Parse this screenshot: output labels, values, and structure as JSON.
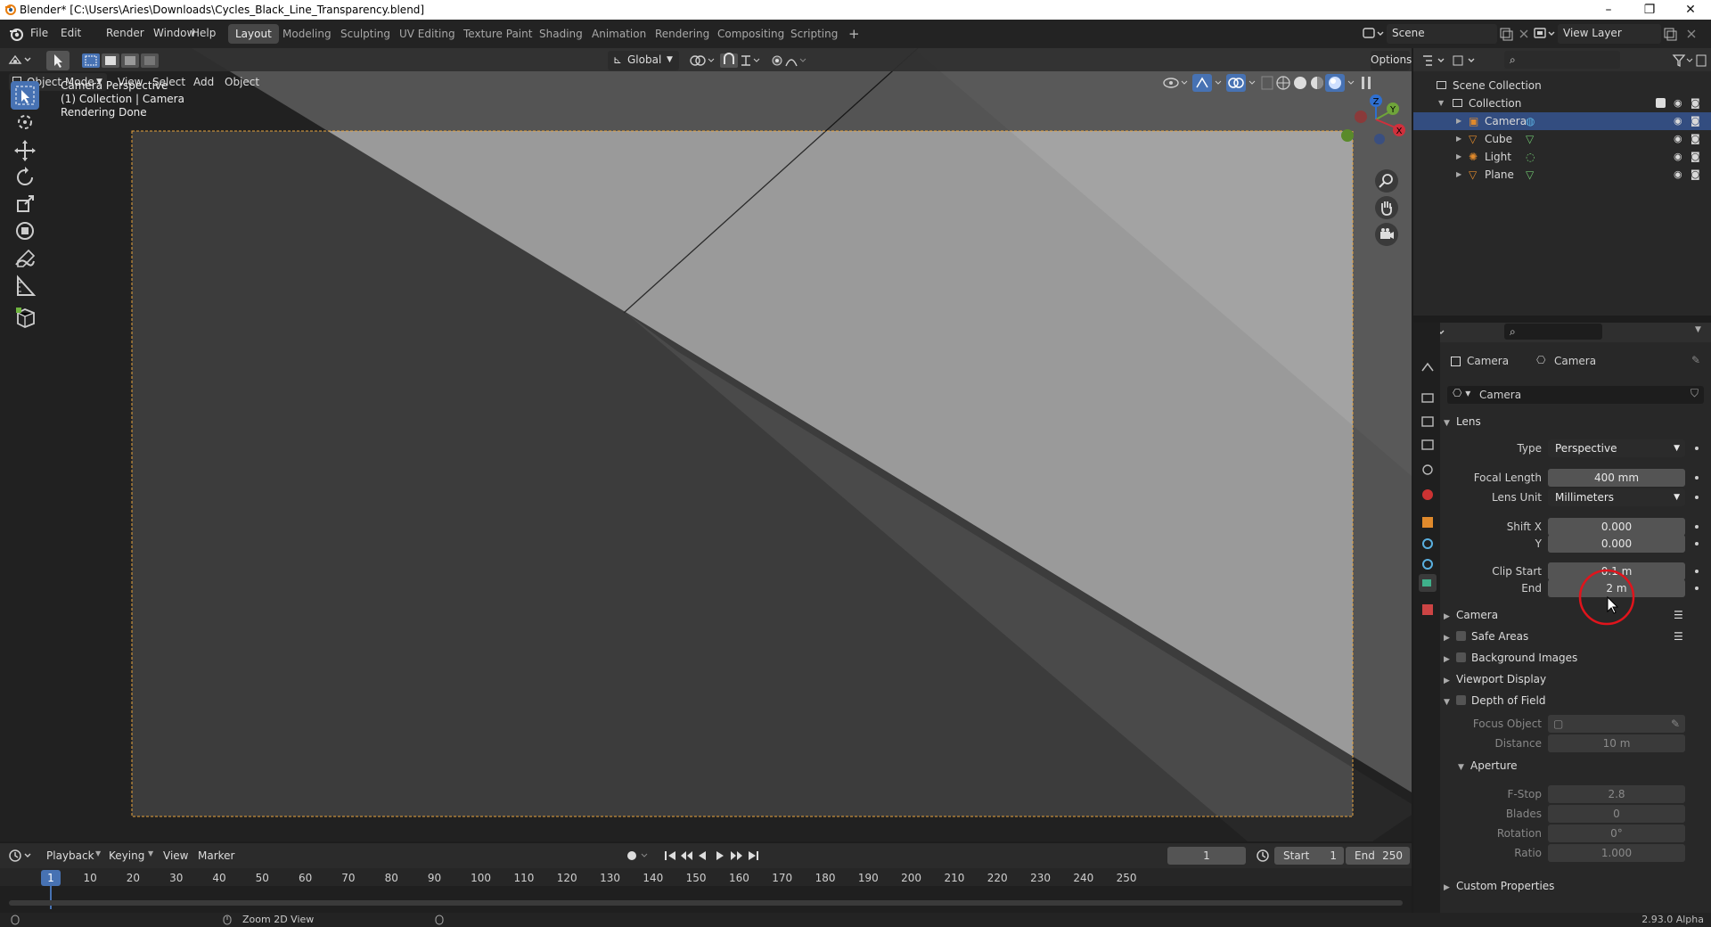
{
  "window": {
    "title": "Blender* [C:\\Users\\Aries\\Downloads\\Cycles_Black_Line_Transparency.blend]",
    "minimize": "–",
    "restore": "❐",
    "close": "✕"
  },
  "menubar": {
    "items": [
      "File",
      "Edit",
      "Render",
      "Window",
      "Help"
    ]
  },
  "workspaces": {
    "tabs": [
      "Layout",
      "Modeling",
      "Sculpting",
      "UV Editing",
      "Texture Paint",
      "Shading",
      "Animation",
      "Rendering",
      "Compositing",
      "Scripting"
    ],
    "active": "Layout",
    "add": "+"
  },
  "scene": {
    "label": "Scene",
    "view_layer": "View Layer"
  },
  "viewport_header": {
    "mode": "Object Mode",
    "menus": [
      "View",
      "Select",
      "Add",
      "Object"
    ],
    "transform_orientation": "Global",
    "options": "Options"
  },
  "viewport": {
    "overlay_line1": "Camera Perspective",
    "overlay_line2": "(1) Collection | Camera",
    "overlay_line3": "Rendering Done",
    "gizmo_z": "Z",
    "gizmo_y": "Y",
    "gizmo_x": "X"
  },
  "outliner": {
    "scene_collection": "Scene Collection",
    "collection": "Collection",
    "items": [
      {
        "name": "Camera",
        "type": "camera",
        "selected": true
      },
      {
        "name": "Cube",
        "type": "mesh",
        "selected": false
      },
      {
        "name": "Light",
        "type": "light",
        "selected": false
      },
      {
        "name": "Plane",
        "type": "mesh",
        "selected": false
      }
    ]
  },
  "properties": {
    "breadcrumb_object": "Camera",
    "breadcrumb_data": "Camera",
    "datablock": "Camera",
    "lens": {
      "title": "Lens",
      "type_label": "Type",
      "type_value": "Perspective",
      "focal_label": "Focal Length",
      "focal_value": "400 mm",
      "lens_unit_label": "Lens Unit",
      "lens_unit_value": "Millimeters",
      "shiftx_label": "Shift X",
      "shiftx_value": "0.000",
      "shifty_label": "Y",
      "shifty_value": "0.000",
      "clip_start_label": "Clip Start",
      "clip_start_value": "0.1 m",
      "clip_end_label": "End",
      "clip_end_value": "2 m"
    },
    "sections": {
      "camera": "Camera",
      "safe_areas": "Safe Areas",
      "background_images": "Background Images",
      "viewport_display": "Viewport Display",
      "depth_of_field": "Depth of Field",
      "aperture": "Aperture",
      "custom_properties": "Custom Properties"
    },
    "dof": {
      "focus_label": "Focus Object",
      "distance_label": "Distance",
      "distance_value": "10 m",
      "fstop_label": "F-Stop",
      "fstop_value": "2.8",
      "blades_label": "Blades",
      "blades_value": "0",
      "rotation_label": "Rotation",
      "rotation_value": "0°",
      "ratio_label": "Ratio",
      "ratio_value": "1.000"
    }
  },
  "timeline": {
    "menus": [
      "Playback",
      "Keying",
      "View",
      "Marker"
    ],
    "current_frame": "1",
    "start_label": "Start",
    "start_value": "1",
    "end_label": "End",
    "end_value": "250",
    "ticks": [
      "10",
      "20",
      "30",
      "40",
      "50",
      "60",
      "70",
      "80",
      "90",
      "100",
      "110",
      "120",
      "130",
      "140",
      "150",
      "160",
      "170",
      "180",
      "190",
      "200",
      "210",
      "220",
      "230",
      "240",
      "250"
    ],
    "playhead": "1"
  },
  "statusbar": {
    "hint": "Zoom 2D View",
    "version": "2.93.0 Alpha"
  },
  "colors": {
    "accent": "#4772b3",
    "camera_frame": "#e8a33c",
    "cursor_ring": "#e0141c"
  }
}
